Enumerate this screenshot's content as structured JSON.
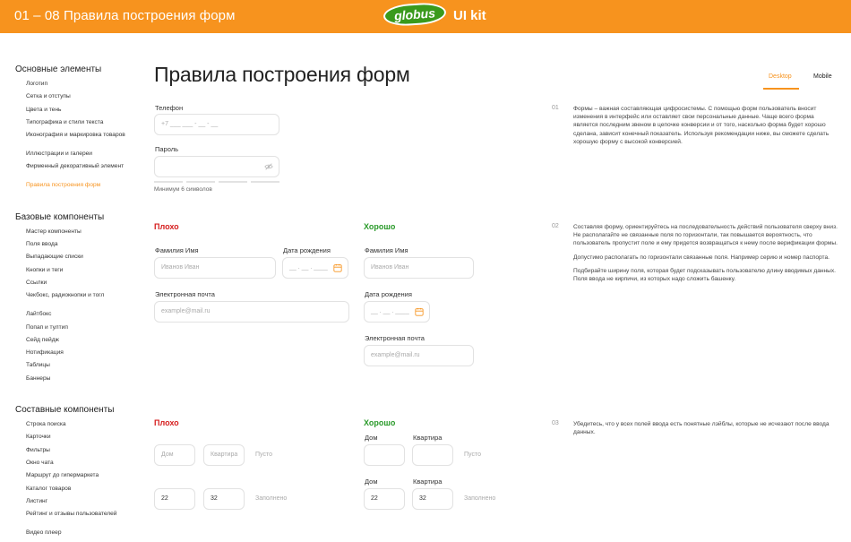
{
  "header": {
    "crumb": "01 – 08  Правила построения форм",
    "logo": "globus",
    "kit": "UI kit"
  },
  "sidebar": {
    "sections": [
      {
        "title": "Основные элементы",
        "items": [
          "Логотип",
          "Сетка и отступы",
          "Цвета и тень",
          "Типографика и стили текста",
          "Иконография и маркировка товаров",
          "Иллюстрации и галереи",
          "Фирменный декоративный элемент",
          "Правила построения форм"
        ],
        "active": 7
      },
      {
        "title": "Базовые компоненты",
        "items": [
          "Мастер компоненты",
          "Поля ввода",
          "Выпадающие списки",
          "Кнопки и теги",
          "Ссылки",
          "Чекбокс, радиокнопки и тогл",
          "Лайтбокс",
          "Попап и тултип",
          "Сейд пейдж",
          "Нотификация",
          "Таблицы",
          "Баннеры"
        ]
      },
      {
        "title": "Составные компоненты",
        "items": [
          "Строка поиска",
          "Карточки",
          "Фильтры",
          "Окно чата",
          "Маршрут до гипермаркета",
          "Каталог товаров",
          "Листинг",
          "Рейтинг и отзывы пользователей",
          "Видео плеер"
        ]
      }
    ]
  },
  "main": {
    "title": "Правила построения форм",
    "tabs": {
      "desktop": "Desktop",
      "mobile": "Mobile"
    },
    "block1": {
      "phone_label": "Телефон",
      "phone_value": "+7  ___  ___ - __ - __",
      "password_label": "Пароль",
      "password_hint": "Минимум 6 символов",
      "num": "01",
      "text": "Формы – важная составляющая цифросистемы. С помощью форм пользователь вносит изменения в интерфейс или оставляет свои персональные данные. Чаще всего форма является последним звеном в цепочке конверсии и от того, насколько форма будет хорошо сделана, зависит конечный показатель. Используя рекомендации ниже, вы сможете сделать хорошую форму с высокой конверсией."
    },
    "block2": {
      "bad": "Плохо",
      "good": "Хорошо",
      "name_label": "Фамилия Имя",
      "name_ph": "Иванов Иван",
      "birth_label": "Дата рождения",
      "birth_ph": "__ . __ . ____",
      "email_label": "Электронная почта",
      "email_ph": "example@mail.ru",
      "num": "02",
      "text1": "Составляя форму, ориентируйтесь на последовательность действий пользователя сверху вниз. Не располагайте не связанные поля по горизонтали, так повышается вероятность, что пользователь пропустит поле и ему придется возвращаться к нему после верификации формы.",
      "text2": "Допустимо располагать по горизонтали связанные поля. Например серию и номер паспорта.",
      "text3": "Подбирайте ширину поля, которая будет подсказывать пользователю длину вводимых данных. Поля ввода не кирпичи, из которых надо сложить башенку."
    },
    "block3": {
      "bad": "Плохо",
      "good": "Хорошо",
      "house_label": "Дом",
      "flat_label": "Квартира",
      "house_ph": "Дом",
      "flat_ph": "Квартира",
      "empty": "Пусто",
      "filled": "Заполнено",
      "house_val": "22",
      "flat_val": "32",
      "num": "03",
      "text": "Убедитесь, что у всех полей ввода есть понятные лэйблы, которые не исчезают после ввода данных."
    }
  },
  "colors": {
    "accent": "#f7931e",
    "good": "#2a9a2a",
    "bad": "#d62020",
    "logo": "#3a9a1c"
  }
}
